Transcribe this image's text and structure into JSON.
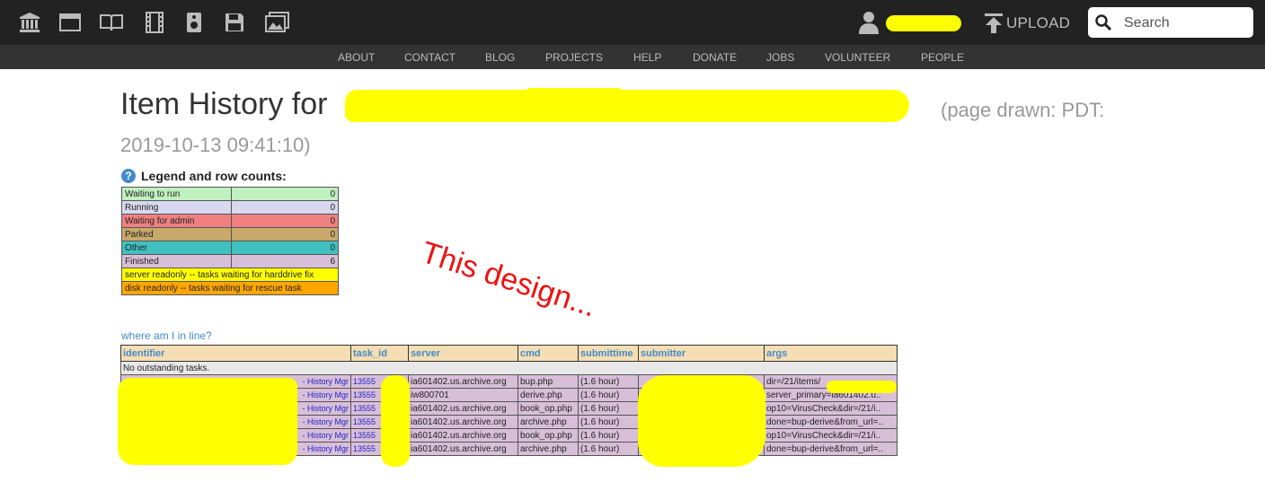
{
  "nav": {
    "icons": [
      "archive-icon",
      "web-icon",
      "texts-icon",
      "video-icon",
      "audio-icon",
      "software-icon",
      "images-icon"
    ],
    "upload_label": "UPLOAD",
    "search_placeholder": "Search"
  },
  "subnav": [
    "ABOUT",
    "CONTACT",
    "BLOG",
    "PROJECTS",
    "HELP",
    "DONATE",
    "JOBS",
    "VOLUNTEER",
    "PEOPLE"
  ],
  "page": {
    "title_prefix": "Item History for",
    "page_drawn": "(page drawn: PDT:",
    "timestamp": "2019-10-13 09:41:10)"
  },
  "legend": {
    "heading": "Legend and row counts:",
    "rows": [
      {
        "label": "Waiting to run",
        "count": "0",
        "color": "#c0f0c0"
      },
      {
        "label": "Running",
        "count": "0",
        "color": "#d8d8f0"
      },
      {
        "label": "Waiting for admin",
        "count": "0",
        "color": "#f08080"
      },
      {
        "label": "Parked",
        "count": "0",
        "color": "#c8a86b"
      },
      {
        "label": "Other",
        "count": "0",
        "color": "#40c0c0"
      },
      {
        "label": "Finished",
        "count": "6",
        "color": "#d8bfd8"
      }
    ],
    "notes": [
      {
        "label": "server readonly -- tasks waiting for harddrive fix",
        "color": "#ffff00"
      },
      {
        "label": "disk readonly -- tasks waiting for rescue task",
        "color": "#ffa500"
      }
    ]
  },
  "annotation": "This design...",
  "where_link": "where am I in line?",
  "tasks": {
    "columns": [
      "identifier",
      "task_id",
      "server",
      "cmd",
      "submittime",
      "submitter",
      "args"
    ],
    "empty_message": "No outstanding tasks.",
    "rows": [
      {
        "identifier": "- History Mgr",
        "task_id": "13555",
        "server": "ia601402.us.archive.org",
        "cmd": "bup.php",
        "submittime": "(1.6 hour)",
        "submitter": "",
        "args": "dir=/21/items/"
      },
      {
        "identifier": "- History Mgr",
        "task_id": "13555",
        "server": "iw800701",
        "cmd": "derive.php",
        "submittime": "(1.6 hour)",
        "submitter": "",
        "args": "server_primary=ia601402.u.."
      },
      {
        "identifier": "- History Mgr",
        "task_id": "13555",
        "server": "ia601402.us.archive.org",
        "cmd": "book_op.php",
        "submittime": "(1.6 hour)",
        "submitter": "",
        "args": "op10=VirusCheck&dir=/21/i.."
      },
      {
        "identifier": "- History Mgr",
        "task_id": "13555",
        "server": "ia601402.us.archive.org",
        "cmd": "archive.php",
        "submittime": "(1.6 hour)",
        "submitter": "",
        "args": "done=bup-derive&from_url=.."
      },
      {
        "identifier": "- History Mgr",
        "task_id": "13555",
        "server": "ia601402.us.archive.org",
        "cmd": "book_op.php",
        "submittime": "(1.6 hour)",
        "submitter": "",
        "args": "op10=VirusCheck&dir=/21/i.."
      },
      {
        "identifier": "- History Mgr",
        "task_id": "13555",
        "server": "ia601402.us.archive.org",
        "cmd": "archive.php",
        "submittime": "(1.6 hour)",
        "submitter": "",
        "args": "done=bup-derive&from_url=.."
      }
    ]
  }
}
